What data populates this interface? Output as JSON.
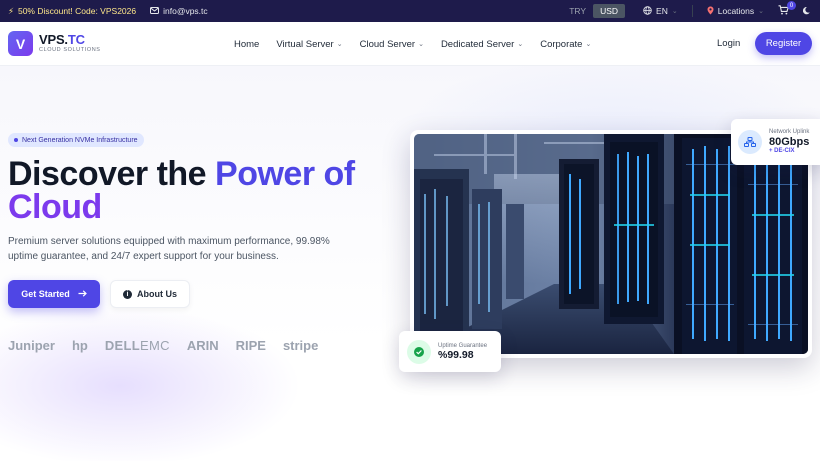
{
  "topbar": {
    "promo": "50% Discount! Code: VPS2026",
    "email": "info@vps.tc",
    "currencies": [
      "TRY",
      "USD"
    ],
    "active_currency": "USD",
    "language": "EN",
    "locations": "Locations",
    "cart_count": "0",
    "colors": {
      "background": "#1e1b4b",
      "promo": "#fde68a"
    }
  },
  "header": {
    "logo_letter": "V",
    "logo_main": "VPS.",
    "logo_accent": "TC",
    "logo_sub": "CLOUD SOLUTIONS",
    "nav": [
      "Home",
      "Virtual Server",
      "Cloud Server",
      "Dedicated Server",
      "Corporate"
    ],
    "login": "Login",
    "register": "Register",
    "colors": {
      "accent": "#4f46e5"
    }
  },
  "hero": {
    "badge": "Next Generation NVMe Infrastructure",
    "headline_part1": "Discover the ",
    "headline_accent1": "Power of",
    "headline_accent2": "Cloud",
    "lead": "Premium server solutions equipped with maximum performance, 99.98% uptime guarantee, and 24/7 expert support for your business.",
    "primary_button": "Get Started",
    "secondary_button": "About Us",
    "partners": [
      "Juniper",
      "hp",
      "DELL",
      "EMC",
      "ARIN",
      "RIPE",
      "stripe"
    ],
    "uplink": {
      "label": "Network Uplink",
      "value": "80Gbps",
      "sub": "+ DE-CIX"
    },
    "uptime": {
      "label": "Uptime Guarantee",
      "value": "%99.98"
    },
    "colors": {
      "accent_blue": "#4f46e5",
      "accent_purple": "#7c3aed"
    }
  }
}
